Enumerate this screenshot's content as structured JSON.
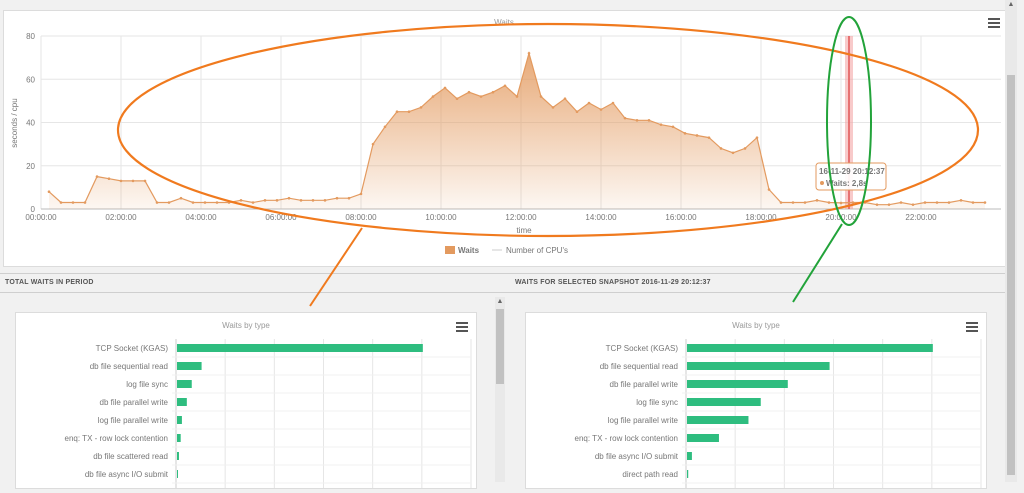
{
  "top_chart": {
    "menu_icon": "hamburger-icon",
    "tooltip": {
      "title": "16-11-29 20:12:37",
      "label": "Waits: 2,8s"
    },
    "legend": [
      "Waits",
      "Number of CPU's"
    ],
    "colors": {
      "waits": "#e39a5f",
      "cpu_line": "#cccccc",
      "highlight": "#f4a6a6"
    }
  },
  "chart_data": [
    {
      "type": "area",
      "title": "Waits",
      "xlabel": "time",
      "ylabel": "seconds / cpu",
      "ylim": [
        0,
        80
      ],
      "yticks": [
        0,
        20,
        40,
        60,
        80
      ],
      "xlim_hours": [
        0,
        24
      ],
      "xtick_labels": [
        "00:00:00",
        "02:00:00",
        "04:00:00",
        "06:00:00",
        "08:00:00",
        "10:00:00",
        "12:00:00",
        "14:00:00",
        "16:00:00",
        "18:00:00",
        "20:00:00",
        "22:00:00"
      ],
      "xtick_hours": [
        0,
        2,
        4,
        6,
        8,
        10,
        12,
        14,
        16,
        18,
        20,
        22
      ],
      "highlight_hour": 20.2,
      "series": [
        {
          "name": "Waits",
          "x_hours": [
            0.2,
            0.5,
            0.8,
            1.1,
            1.4,
            1.7,
            2.0,
            2.3,
            2.6,
            2.9,
            3.2,
            3.5,
            3.8,
            4.1,
            4.4,
            4.7,
            5.0,
            5.3,
            5.6,
            5.9,
            6.2,
            6.5,
            6.8,
            7.1,
            7.4,
            7.7,
            8.0,
            8.3,
            8.6,
            8.9,
            9.2,
            9.5,
            9.8,
            10.1,
            10.4,
            10.7,
            11.0,
            11.3,
            11.6,
            11.9,
            12.2,
            12.5,
            12.8,
            13.1,
            13.4,
            13.7,
            14.0,
            14.3,
            14.6,
            14.9,
            15.2,
            15.5,
            15.8,
            16.1,
            16.4,
            16.7,
            17.0,
            17.3,
            17.6,
            17.9,
            18.2,
            18.5,
            18.8,
            19.1,
            19.4,
            19.7,
            20.0,
            20.3,
            20.6,
            20.9,
            21.2,
            21.5,
            21.8,
            22.1,
            22.4,
            22.7,
            23.0,
            23.3,
            23.6
          ],
          "values": [
            8,
            3,
            3,
            3,
            15,
            14,
            13,
            13,
            13,
            3,
            3,
            5,
            3,
            3,
            3,
            3,
            4,
            3,
            4,
            4,
            5,
            4,
            4,
            4,
            5,
            5,
            7,
            30,
            38,
            45,
            45,
            47,
            52,
            56,
            51,
            54,
            52,
            54,
            57,
            52,
            72,
            52,
            47,
            51,
            45,
            49,
            46,
            49,
            42,
            41,
            41,
            39,
            38,
            35,
            34,
            33,
            28,
            26,
            28,
            33,
            9,
            3,
            3,
            3,
            4,
            3,
            2.8,
            3,
            3,
            2,
            2,
            3,
            2,
            3,
            3,
            3,
            4,
            3,
            3
          ]
        },
        {
          "name": "Number of CPU's",
          "values": []
        }
      ]
    },
    {
      "type": "bar",
      "title": "Waits by type",
      "categories": [
        "TCP Socket (KGAS)",
        "db file sequential read",
        "log file sync",
        "db file parallel write",
        "log file parallel write",
        "enq: TX - row lock contention",
        "db file scattered read",
        "db file async I/O submit"
      ],
      "values": [
        100,
        10,
        6,
        4,
        2,
        1.5,
        0.8,
        0.3
      ],
      "xlim": [
        0,
        120
      ]
    },
    {
      "type": "bar",
      "title": "Waits by type",
      "categories": [
        "TCP Socket (KGAS)",
        "db file sequential read",
        "db file parallel write",
        "log file sync",
        "log file parallel write",
        "enq: TX - row lock contention",
        "db file async I/O submit",
        "direct path read"
      ],
      "values": [
        100,
        58,
        41,
        30,
        25,
        13,
        2,
        0.5
      ],
      "xlim": [
        0,
        120
      ]
    }
  ],
  "sections": {
    "total_waits": "TOTAL WAITS IN PERIOD",
    "selected_snapshot": "WAITS FOR SELECTED SNAPSHOT 2016-11-29 20:12:37"
  },
  "left_chart": {
    "menu_icon": "hamburger-icon",
    "bar_color": "#2ebd7f"
  },
  "right_chart": {
    "menu_icon": "hamburger-icon",
    "bar_color": "#2ebd7f"
  },
  "annotations": {
    "ellipse_orange": "#f07a1e",
    "ellipse_green": "#22a33a"
  }
}
